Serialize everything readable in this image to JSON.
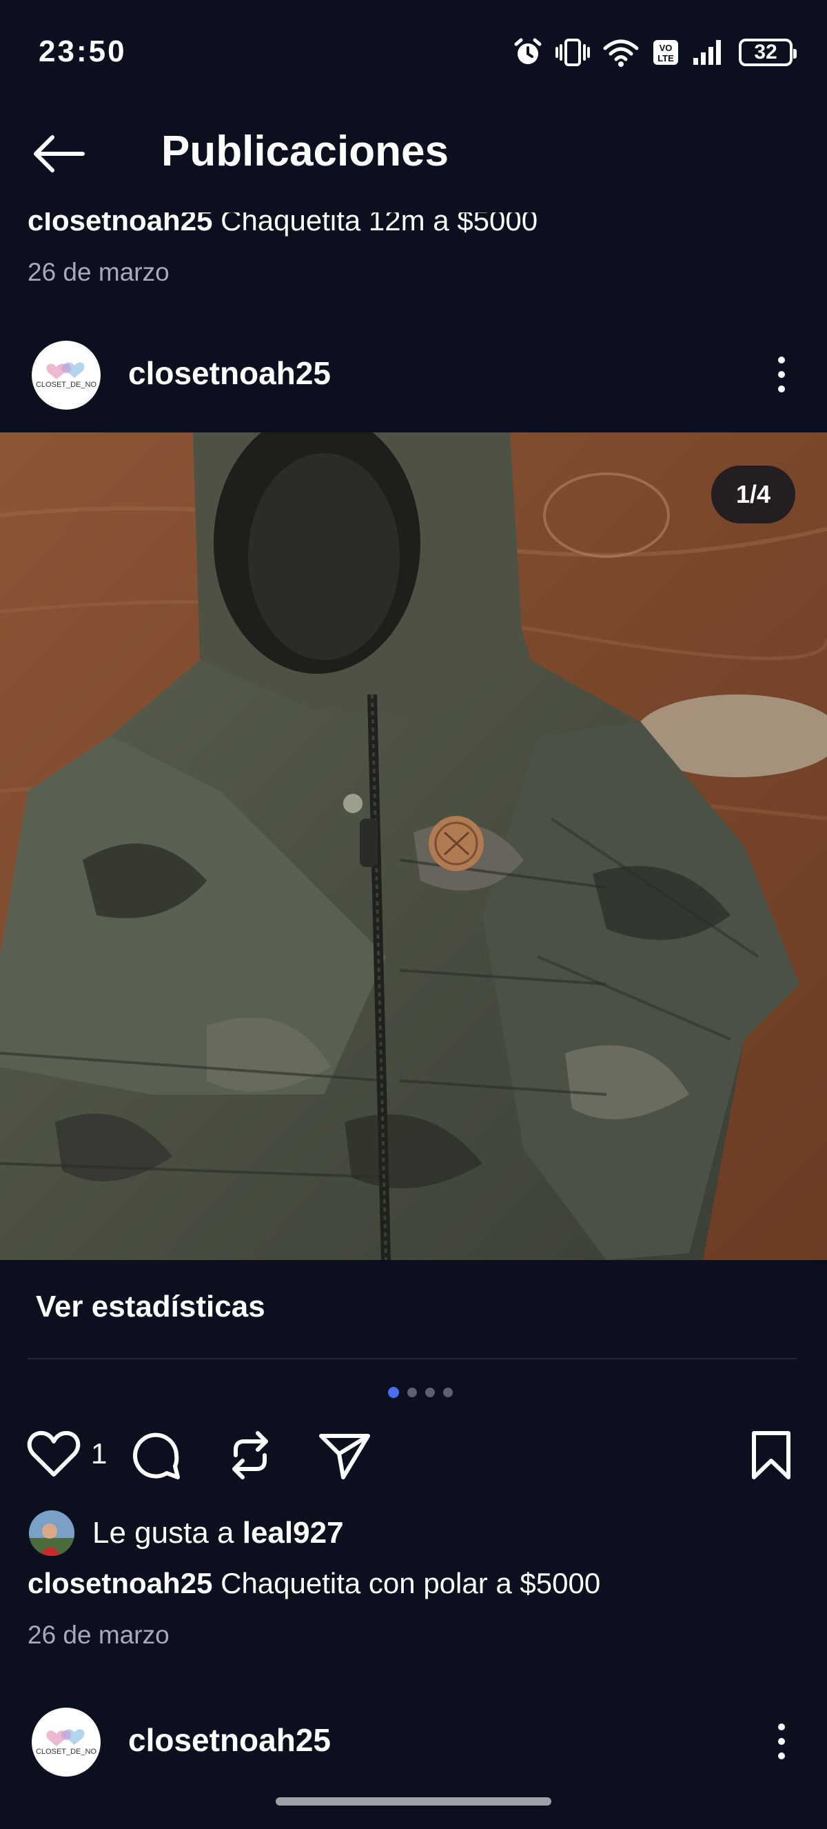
{
  "status_bar": {
    "time": "23:50",
    "battery": "32",
    "icons": [
      "alarm-icon",
      "vibrate-icon",
      "wifi-icon",
      "volte-icon",
      "signal-icon",
      "battery-icon"
    ]
  },
  "header": {
    "title": "Publicaciones",
    "back_icon": "arrow-left-icon"
  },
  "previous_post": {
    "username": "closetnoah25",
    "caption": "Chaquetita 12m a $5000",
    "date": "26 de marzo"
  },
  "post": {
    "username": "closetnoah25",
    "avatar_text": "CLOSET_DE_NO",
    "image_counter": "1/4",
    "stats_link": "Ver estadísticas",
    "carousel": {
      "count": 4,
      "active": 0
    },
    "like_count": "1",
    "liked_by_prefix": "Le gusta a ",
    "liked_by_user": "leal927",
    "caption_user": "closetnoah25",
    "caption_text": "Chaquetita con polar a $5000",
    "date": "26 de marzo"
  },
  "next_post": {
    "username": "closetnoah25",
    "avatar_text": "CLOSET_DE_NO"
  },
  "colors": {
    "background": "#0c0f1d",
    "muted_text": "#a7abb8",
    "carousel_active": "#4c6ef5"
  }
}
